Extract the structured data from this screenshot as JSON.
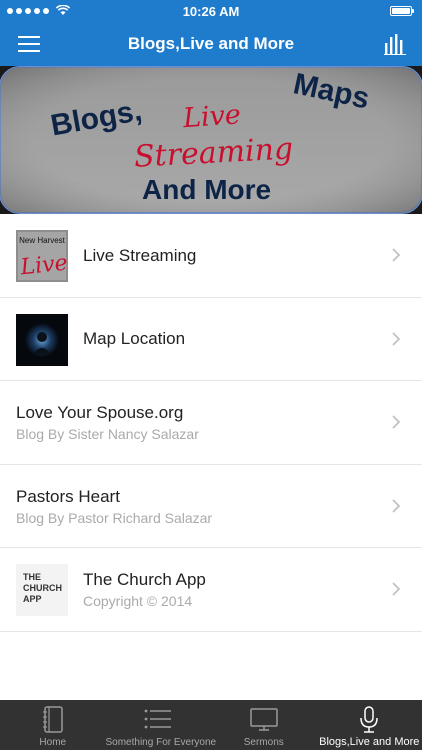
{
  "status_bar": {
    "time": "10:26 AM"
  },
  "nav": {
    "title": "Blogs,Live and More"
  },
  "banner": {
    "text_blogs": "Blogs,",
    "text_live": "Live",
    "text_maps": "Maps",
    "text_streaming": "Streaming",
    "text_and_more": "And More"
  },
  "list": {
    "items": [
      {
        "title": "Live Streaming",
        "thumb_text_top": "New Harvest",
        "thumb_text_big": "Live"
      },
      {
        "title": "Map Location"
      },
      {
        "title": "Love Your Spouse.org",
        "subtitle": "Blog By Sister Nancy Salazar"
      },
      {
        "title": "Pastors Heart",
        "subtitle": "Blog By Pastor Richard Salazar"
      },
      {
        "title": "The Church App",
        "subtitle": "Copyright © 2014",
        "thumb_lines": [
          "THE",
          "CHURCH",
          "APP"
        ]
      }
    ]
  },
  "tabs": [
    {
      "label": "Home",
      "icon": "notebook-icon"
    },
    {
      "label": "Something For Everyone",
      "icon": "list-icon"
    },
    {
      "label": "Sermons",
      "icon": "tv-icon"
    },
    {
      "label": "Blogs,Live and More",
      "icon": "microphone-icon",
      "active": true
    }
  ],
  "colors": {
    "nav_blue": "#1f7ccc",
    "tab_bar": "#323232",
    "banner_red": "#c8102e",
    "banner_navy": "#0d2447"
  }
}
